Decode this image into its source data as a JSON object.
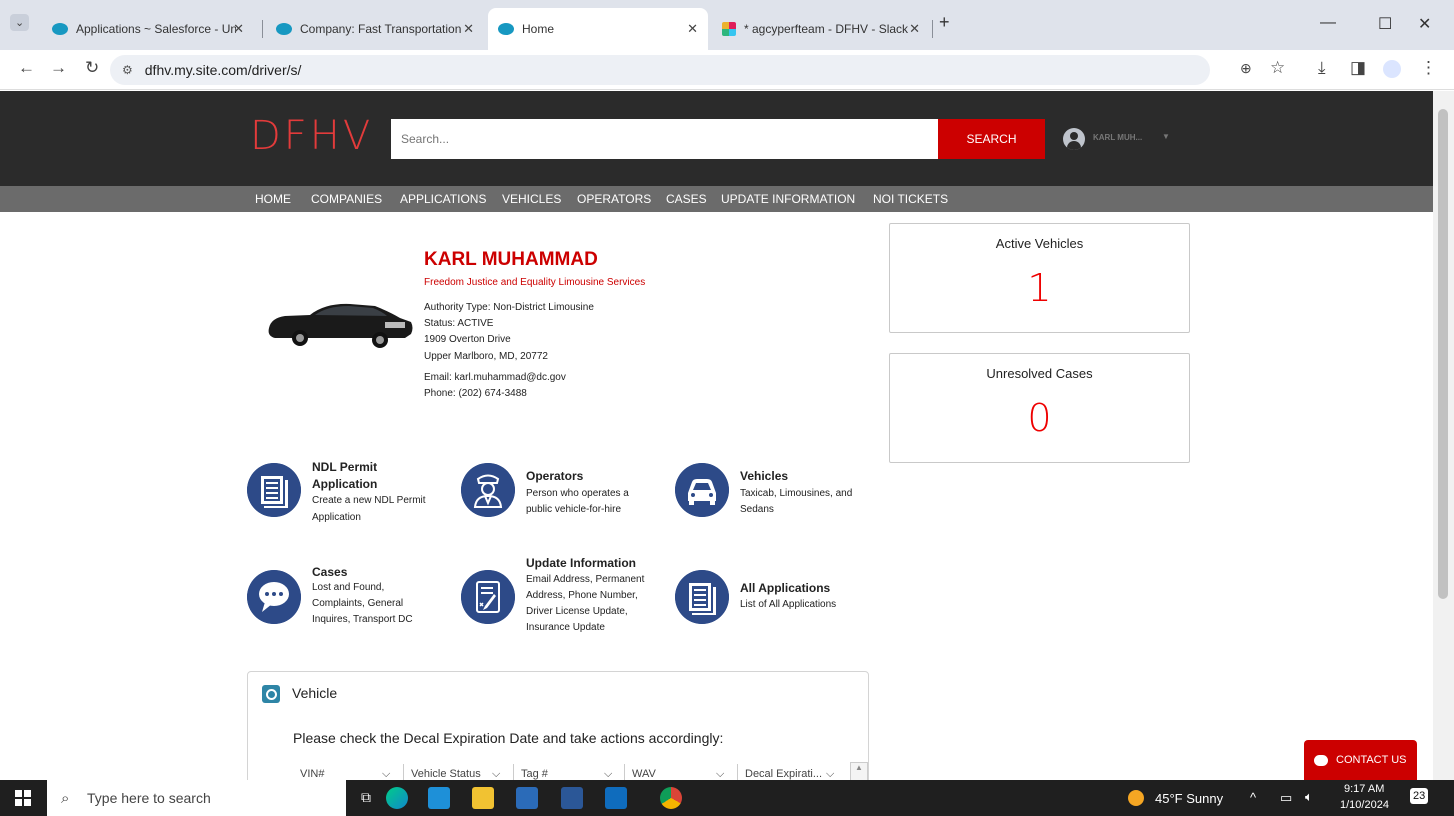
{
  "browser": {
    "tabs": [
      {
        "title": "Applications ~ Salesforce - Unli",
        "icon": "salesforce-cloud-icon"
      },
      {
        "title": "Company: Fast Transportation S",
        "icon": "salesforce-cloud-icon"
      },
      {
        "title": "Home",
        "icon": "salesforce-cloud-icon"
      },
      {
        "title": "* agcyperfteam - DFHV - Slack",
        "icon": "slack-icon"
      }
    ],
    "url": "dfhv.my.site.com/driver/s/"
  },
  "header": {
    "logo": "DFHV",
    "search_placeholder": "Search...",
    "search_button": "SEARCH",
    "user_name": "KARL MUH...",
    "brand_color": "#e23b3b"
  },
  "nav": {
    "items": [
      "HOME",
      "COMPANIES",
      "APPLICATIONS",
      "VEHICLES",
      "OPERATORS",
      "CASES",
      "UPDATE INFORMATION",
      "NOI TICKETS"
    ]
  },
  "profile": {
    "name": "KARL MUHAMMAD",
    "company": "Freedom Justice and Equality Limousine Services",
    "authority_type": "Authority Type: Non-District Limousine",
    "status": "Status: ACTIVE",
    "address1": "1909 Overton Drive",
    "address2": "Upper Marlboro, MD, 20772",
    "email": "Email: karl.muhammad@dc.gov",
    "phone": "Phone: (202) 674-3488"
  },
  "stats": {
    "active_vehicles": {
      "label": "Active Vehicles",
      "value": "1"
    },
    "unresolved_cases": {
      "label": "Unresolved Cases",
      "value": "0"
    }
  },
  "tiles": [
    {
      "title1": "NDL Permit",
      "title2": "Application",
      "desc1": "Create a new NDL Permit",
      "desc2": "Application",
      "icon": "document-stack-icon"
    },
    {
      "title1": "Operators",
      "desc1": "Person who operates a",
      "desc2": "public vehicle-for-hire",
      "icon": "chauffeur-icon"
    },
    {
      "title1": "Vehicles",
      "desc1": "Taxicab, Limousines, and",
      "desc2": "Sedans",
      "icon": "car-icon"
    },
    {
      "title1": "Cases",
      "desc1": "Lost and Found,",
      "desc2": "Complaints, General",
      "desc3": "Inquires, Transport DC",
      "icon": "chat-bubble-icon"
    },
    {
      "title1": "Update Information",
      "desc1": "Email Address, Permanent",
      "desc2": "Address, Phone Number,",
      "desc3": "Driver License Update,",
      "desc4": "Insurance Update",
      "icon": "edit-document-icon"
    },
    {
      "title1": "All Applications",
      "desc1": "List of All Applications",
      "icon": "document-stack-icon"
    }
  ],
  "vehicle_card": {
    "title": "Vehicle",
    "message": "Please check the Decal Expiration Date and take actions accordingly:",
    "columns": [
      "VIN#",
      "Vehicle Status",
      "Tag #",
      "WAV",
      "Decal Expirati..."
    ]
  },
  "contact": {
    "label": "CONTACT US"
  },
  "taskbar": {
    "search_placeholder": "Type here to search",
    "weather": "45°F  Sunny",
    "time": "9:17 AM",
    "date": "1/10/2024",
    "notifications": "23"
  }
}
